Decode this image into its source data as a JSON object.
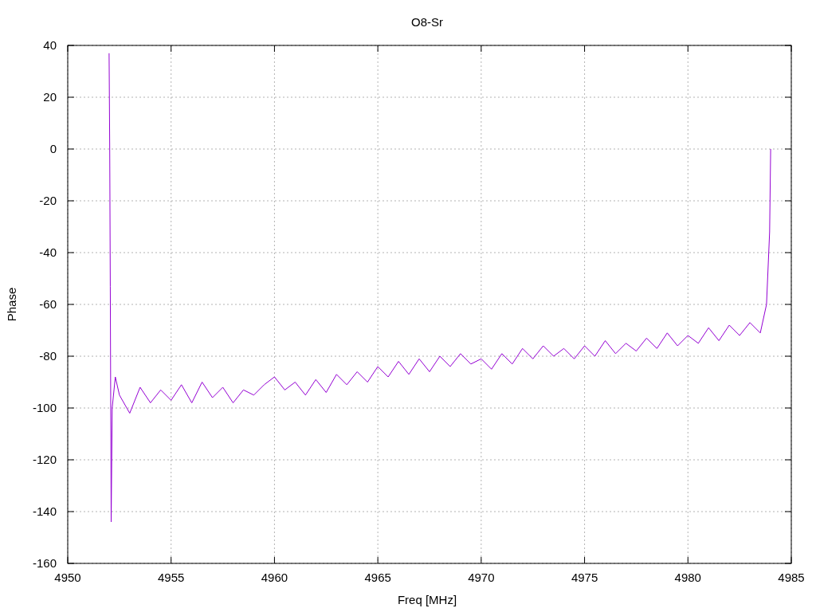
{
  "chart_data": {
    "type": "line",
    "title": "O8-Sr",
    "xlabel": "Freq [MHz]",
    "ylabel": "Phase",
    "xlim": [
      4950,
      4985
    ],
    "ylim": [
      -160,
      40
    ],
    "xticks": [
      4950,
      4955,
      4960,
      4965,
      4970,
      4975,
      4980,
      4985
    ],
    "grid": true,
    "yticks": [
      -160,
      -140,
      -120,
      -100,
      -80,
      -60,
      -40,
      -20,
      0,
      20,
      40
    ],
    "x": [
      4952.0,
      4952.03,
      4952.06,
      4952.1,
      4952.15,
      4952.3,
      4952.5,
      4953,
      4953.5,
      4954,
      4954.5,
      4955,
      4955.5,
      4956,
      4956.5,
      4957,
      4957.5,
      4958,
      4958.5,
      4959,
      4959.5,
      4960,
      4960.5,
      4961,
      4961.5,
      4962,
      4962.5,
      4963,
      4963.5,
      4964,
      4964.5,
      4965,
      4965.5,
      4966,
      4966.5,
      4967,
      4967.5,
      4968,
      4968.5,
      4969,
      4969.5,
      4970,
      4970.5,
      4971,
      4971.5,
      4972,
      4972.5,
      4973,
      4973.5,
      4974,
      4974.5,
      4975,
      4975.5,
      4976,
      4976.5,
      4977,
      4977.5,
      4978,
      4978.5,
      4979,
      4979.5,
      4980,
      4980.5,
      4981,
      4981.5,
      4982,
      4982.5,
      4983,
      4983.5,
      4983.8,
      4983.95,
      4984.0
    ],
    "series": [
      {
        "color": "#9400d3",
        "values": [
          37,
          0,
          -53,
          -144,
          -100,
          -88,
          -95,
          -102,
          -92,
          -98,
          -93,
          -97,
          -91,
          -98,
          -90,
          -96,
          -92,
          -98,
          -93,
          -95,
          -91,
          -88,
          -93,
          -90,
          -95,
          -89,
          -94,
          -87,
          -91,
          -86,
          -90,
          -84,
          -88,
          -82,
          -87,
          -81,
          -86,
          -80,
          -84,
          -79,
          -83,
          -81,
          -85,
          -79,
          -83,
          -77,
          -81,
          -76,
          -80,
          -77,
          -81,
          -76,
          -80,
          -74,
          -79,
          -75,
          -78,
          -73,
          -77,
          -71,
          -76,
          -72,
          -75,
          -69,
          -74,
          -68,
          -72,
          -67,
          -71,
          -60,
          -32,
          0
        ]
      }
    ]
  }
}
